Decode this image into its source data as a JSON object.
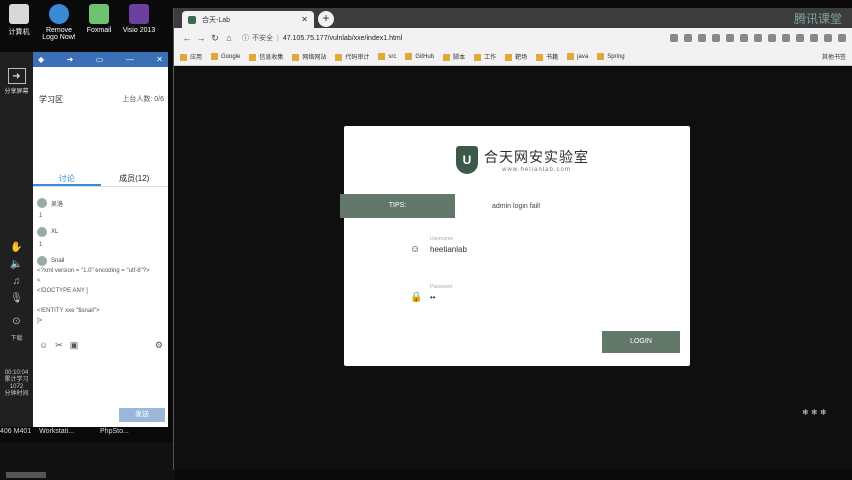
{
  "desktop": {
    "icons": [
      {
        "label": "计算机",
        "icon": "computer-icon"
      },
      {
        "label": "Remove Logo Now!",
        "icon": "remove-logo-icon"
      },
      {
        "label": "Foxmail",
        "icon": "foxmail-icon"
      },
      {
        "label": "Visio 2013",
        "icon": "visio-icon"
      }
    ]
  },
  "left_strip": {
    "share_label": "分享屏幕",
    "download_label": "下载",
    "timer": "00:10:04",
    "stats_line1": "累计学习",
    "stats_line2": "1072",
    "stats_line3": "分钟时间"
  },
  "chat": {
    "room_title": "学习区",
    "online_count": "上台人数: 0/6",
    "tabs": [
      {
        "label": "讨论",
        "active": true
      },
      {
        "label": "成员(12)",
        "active": false
      }
    ],
    "messages": [
      {
        "user": "吴洛",
        "body": "1"
      },
      {
        "user": "XL",
        "body": "1"
      },
      {
        "user": "Snail",
        "body": ""
      }
    ],
    "code_lines": [
      "<?xml version = \"1.0\" encoding = \"utf-8\"?>",
      "<",
      "<!DOCTYPE ANY [",
      "",
      "<!ENTITY xxe \"$snail\">",
      "]>"
    ],
    "send_label": "发送"
  },
  "taskbar": {
    "labels": [
      "406 M401",
      "Workstati...",
      "PhpSto..."
    ]
  },
  "browser": {
    "tab_title": "合天-Lab",
    "security_label": "不安全",
    "url": "47.105.75.177/vulnlab/xxe/index1.html",
    "bookmarks": [
      "应用",
      "Google",
      "信息收集",
      "网络网站",
      "代码审计",
      "src",
      "GitHub",
      "脚本",
      "工作",
      "靶场",
      "书籍",
      "java",
      "Spring"
    ],
    "bookmarks_right": "其他书签",
    "watermark": "腾讯课堂"
  },
  "login": {
    "logo_cn": "合天网安实验室",
    "logo_en": "www.hetianlab.com",
    "tips_label": "TIPS:",
    "tips_message": "admin login fail!",
    "username_label": "Username",
    "username_value": "heetianlab",
    "password_label": "Password",
    "password_value": "••",
    "login_button": "LOGIN"
  }
}
